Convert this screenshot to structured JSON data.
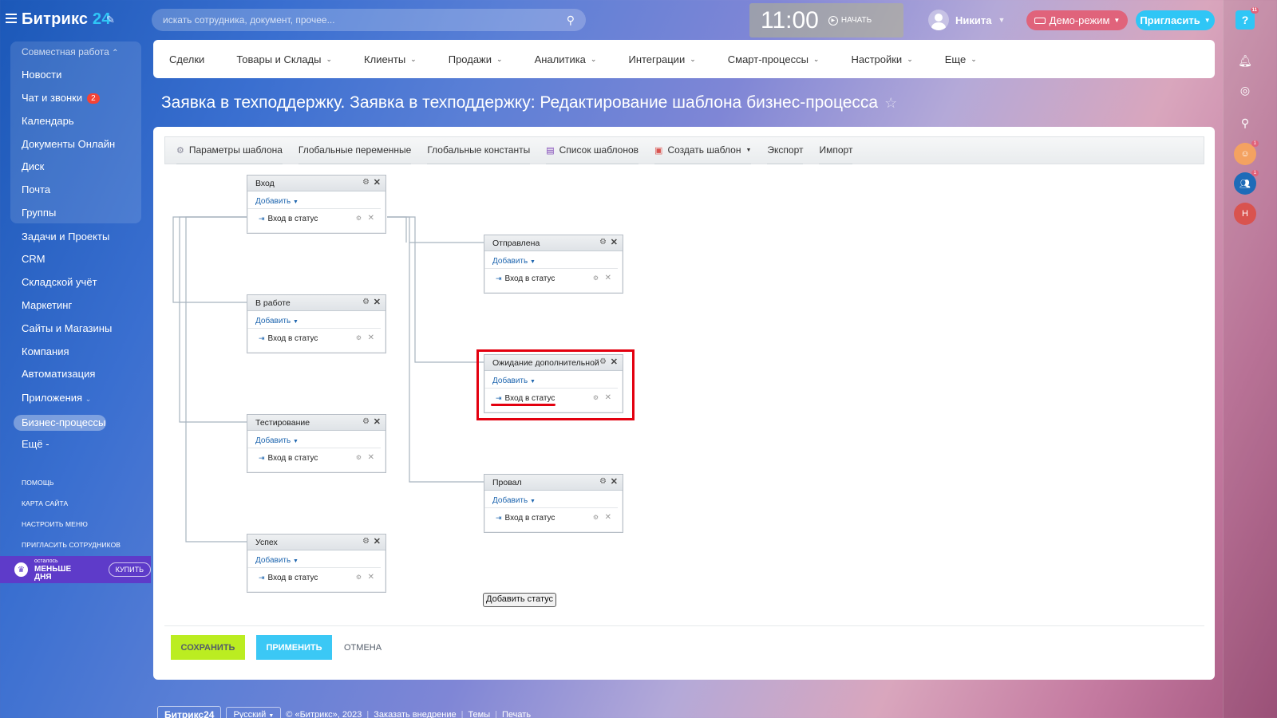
{
  "header": {
    "logo_text": "Битрикс",
    "logo_num": "24",
    "search_placeholder": "искать сотрудника, документ, прочее...",
    "clock_time": "11:00",
    "clock_start": "НАЧАТЬ",
    "user_name": "Никита",
    "demo_label": "Демо-режим",
    "invite_label": "Пригласить"
  },
  "rightbar": {
    "help_badge": "11",
    "avatar1_badge": "1",
    "avatar2_badge": "1",
    "user_initial": "Н"
  },
  "sidebar": {
    "group_header": "Совместная работа",
    "items": [
      {
        "label": "Новости"
      },
      {
        "label": "Чат и звонки",
        "badge": "2"
      },
      {
        "label": "Календарь"
      },
      {
        "label": "Документы Онлайн"
      },
      {
        "label": "Диск"
      },
      {
        "label": "Почта"
      },
      {
        "label": "Группы"
      },
      {
        "label": "Задачи и Проекты"
      },
      {
        "label": "CRM"
      },
      {
        "label": "Складской учёт"
      },
      {
        "label": "Маркетинг"
      },
      {
        "label": "Сайты и Магазины"
      },
      {
        "label": "Компания"
      },
      {
        "label": "Автоматизация"
      },
      {
        "label": "Приложения"
      },
      {
        "label": "Бизнес-процессы"
      },
      {
        "label": "Ещё -"
      }
    ],
    "small_links": [
      "ПОМОЩЬ",
      "КАРТА САЙТА",
      "НАСТРОИТЬ МЕНЮ",
      "ПРИГЛАСИТЬ СОТРУДНИКОВ"
    ],
    "promo_small": "осталось",
    "promo_large": "МЕНЬШЕ ДНЯ",
    "promo_buy": "КУПИТЬ"
  },
  "topmenu": [
    "Сделки",
    "Товары и Склады",
    "Клиенты",
    "Продажи",
    "Аналитика",
    "Интеграции",
    "Смарт-процессы",
    "Настройки",
    "Еще"
  ],
  "page_title": "Заявка в техподдержку. Заявка в техподдержку: Редактирование шаблона бизнес-процесса",
  "toolbar": {
    "params": "Параметры шаблона",
    "globals": "Глобальные переменные",
    "constants": "Глобальные константы",
    "list": "Список шаблонов",
    "create": "Создать шаблон",
    "export": "Экспорт",
    "import": "Импорт"
  },
  "statuses": [
    {
      "title": "Вход",
      "add": "Добавить",
      "action": "Вход в статус"
    },
    {
      "title": "В работе",
      "add": "Добавить",
      "action": "Вход в статус"
    },
    {
      "title": "Тестирование",
      "add": "Добавить",
      "action": "Вход в статус"
    },
    {
      "title": "Успех",
      "add": "Добавить",
      "action": "Вход в статус"
    },
    {
      "title": "Отправлена",
      "add": "Добавить",
      "action": "Вход в статус"
    },
    {
      "title": "Ожидание дополнительной",
      "add": "Добавить",
      "action": "Вход в статус"
    },
    {
      "title": "Провал",
      "add": "Добавить",
      "action": "Вход в статус"
    }
  ],
  "add_status_label": "Добавить статус",
  "buttons": {
    "save": "СОХРАНИТЬ",
    "apply": "ПРИМЕНИТЬ",
    "cancel": "ОТМЕНА"
  },
  "footer": {
    "logo": "Битрикс24",
    "lang": "Русский",
    "copyright": "© «Битрикс», 2023",
    "order": "Заказать внедрение",
    "themes": "Темы",
    "print": "Печать"
  },
  "colors": {
    "accent": "#2fc6f6",
    "save_green": "#bbed21",
    "highlight_red": "#e3000f"
  }
}
